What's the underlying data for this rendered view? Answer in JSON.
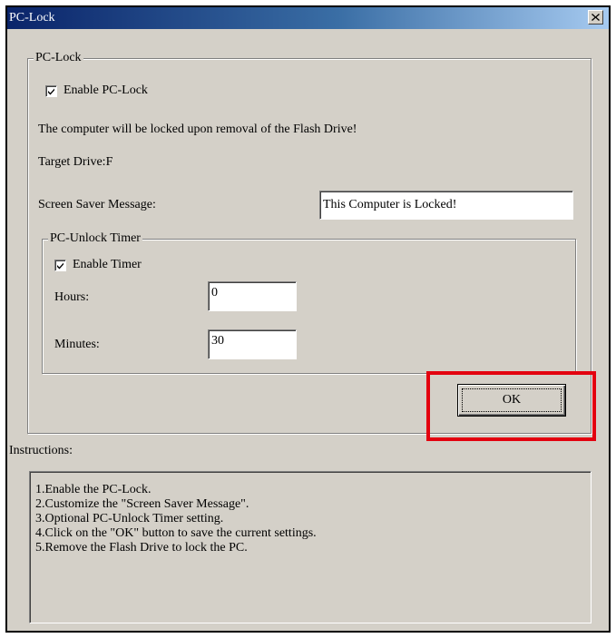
{
  "window": {
    "title": "PC-Lock",
    "close_label": "×"
  },
  "pc_lock_group": {
    "legend": "PC-Lock",
    "enable_label": "Enable PC-Lock",
    "enable_checked": true,
    "notice": "The computer will be locked upon removal of the Flash Drive!",
    "target_drive": "Target Drive:F",
    "screen_saver_label": "Screen Saver Message:",
    "screen_saver_value": "This Computer is Locked!"
  },
  "unlock_timer_group": {
    "legend": "PC-Unlock Timer",
    "enable_label": "Enable Timer",
    "enable_checked": true,
    "hours_label": "Hours:",
    "hours_value": "0",
    "minutes_label": "Minutes:",
    "minutes_value": "30"
  },
  "ok_button": {
    "label": "OK"
  },
  "highlight_color": "#e3000f",
  "instructions": {
    "label": "Instructions:",
    "lines": [
      "1.Enable the PC-Lock.",
      "2.Customize the \"Screen Saver Message\".",
      "3.Optional PC-Unlock Timer setting.",
      "4.Click on the \"OK\" button to save the current settings.",
      "5.Remove the Flash Drive to lock the PC."
    ]
  }
}
